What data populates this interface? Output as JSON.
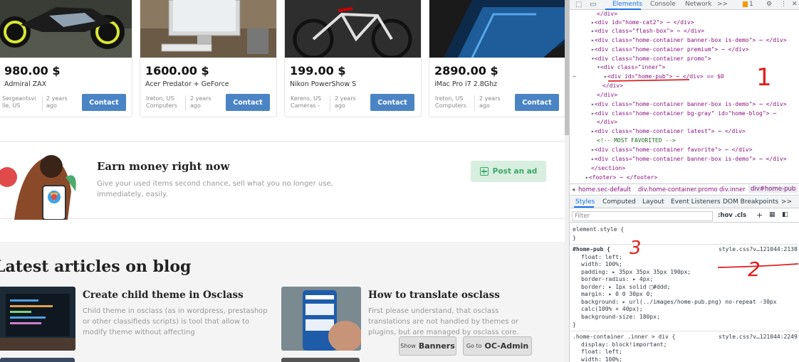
{
  "listings": [
    {
      "price": "980.00 $",
      "title": "Admiral ZAX",
      "location": "Sergeantsvi lle, US",
      "age": "2 years ago",
      "contact": "Contact"
    },
    {
      "price": "1600.00 $",
      "title": "Acer Predator + GeForce",
      "location": "Ireton, US Computers",
      "age": "2 years ago",
      "contact": "Contact"
    },
    {
      "price": "199.00 $",
      "title": "Nikon PowerShow S",
      "location": "Kerens, US Cameras -",
      "age": "2 years ago",
      "contact": "Contact"
    },
    {
      "price": "2890.00 $",
      "title": "iMac Pro i7 2.8Ghz",
      "location": "Ireton, US Computers",
      "age": "2 years ago",
      "contact": "Contact"
    }
  ],
  "promo": {
    "title": "Earn money right now",
    "text": "Give your used items second chance, sell what you no longer use, immediately, easily.",
    "button": "Post an ad"
  },
  "blog": {
    "heading": "Latest articles on blog",
    "articles": [
      {
        "title": "Create child theme in Osclass",
        "text": "Child theme in osclass (as in wordpress, prestashop or other classifieds scripts) is tool that allow to modify theme without affecting"
      },
      {
        "title": "How to translate osclass",
        "text": "First please understand, that osclass translations are not handled by themes or plugins, but are managed by osclass core."
      }
    ]
  },
  "floating": {
    "show_small": "Show",
    "show_big": "Banners",
    "admin_small": "Go to",
    "admin_big": "OC-Admin"
  },
  "devtools": {
    "tabs": [
      "Elements",
      "Console",
      "Network",
      ">>"
    ],
    "badge": "1",
    "dom_lines": [
      "</div>",
      "<div id=\"home-cat2\"> ⋯ </div>",
      "<div class=\"flash-box\"> ⋯ </div>",
      "<div class=\"home-container banner-box is-demo\"> ⋯ </div>",
      "<div class=\"home-container premium\"> ⋯ </div>",
      "<div class=\"home-container promo\">",
      "<div class=\"inner\">",
      "<div id=\"home-pub\"> ⋯ </div> == $0",
      "</div>",
      "</div>",
      "<div class=\"home-container banner-box is-demo\"> ⋯ </div>",
      "<div class=\"home-container bg-gray\" id=\"home-blog\"> ⋯",
      "</div>",
      "<div class=\"home-container latest\"> ⋯ </div>",
      "<!-- MOST FAVORITED -->",
      "<div class=\"home-container favorite\"> ⋯ </div>",
      "<div class=\"home-container banner-box is-demo\"> ⋯ </div>",
      "</section>",
      "<footer> ⋯ </footer>"
    ],
    "breadcrumbs": [
      "home.sec-default",
      "div.home-container.promo",
      "div.inner",
      "div#home-pub"
    ],
    "subtabs": [
      "Styles",
      "Computed",
      "Layout",
      "Event Listeners",
      "DOM Breakpoints",
      ">>"
    ],
    "filter_placeholder": "Filter",
    "filter_tools": ":hov  .cls",
    "styles": {
      "element_style": "element.style {",
      "close": "}",
      "rule1_selector": "#home-pub {",
      "rule1_source": "style.css?v…121044:2138",
      "rule1_props": [
        "float: left;",
        "width: 100%;",
        "padding: ▸ 35px 35px 35px 190px;",
        "border-radius: ▸ 4px;",
        "border: ▸ 1px solid □#ddd;",
        "margin: ▸ 0 0 30px 0;",
        "background: ▸ url(../images/home-pub.png) no-repeat -30px",
        "    calc(100% + 40px);",
        "background-size: 180px;"
      ],
      "rule2_selector": ".home-container .inner > div {",
      "rule2_source": "style.css?v…121044:2249",
      "rule2_props": [
        "display: block!important;",
        "float: left;",
        "width: 100%;"
      ]
    },
    "annotations": [
      "1",
      "2",
      "3"
    ],
    "annotation_color": "#e02020"
  }
}
